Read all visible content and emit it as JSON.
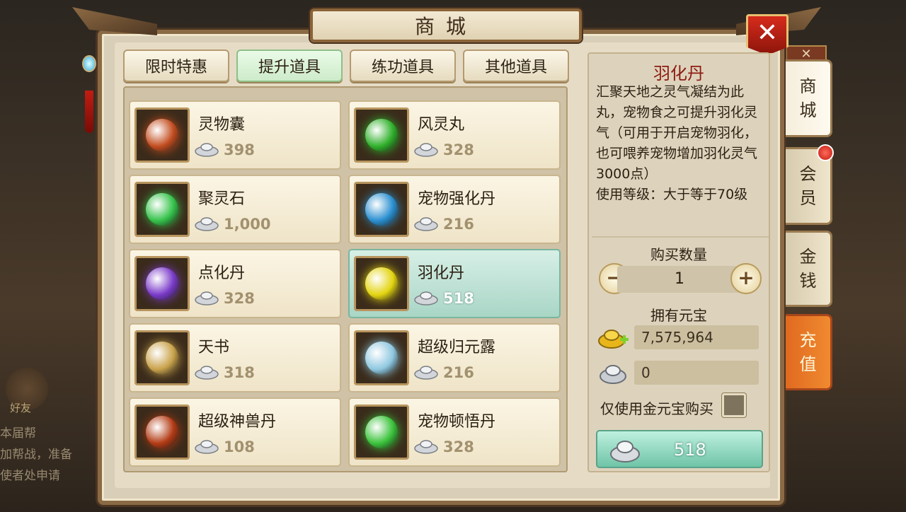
{
  "window": {
    "title": "商城",
    "close_label": "✕"
  },
  "background": {
    "badge_text": "好友",
    "lines": [
      "本届帮",
      "加帮战，准备",
      "使者处申请"
    ],
    "tag": ""
  },
  "tabs": [
    {
      "label": "限时特惠",
      "active": false
    },
    {
      "label": "提升道具",
      "active": true
    },
    {
      "label": "练功道具",
      "active": false
    },
    {
      "label": "其他道具",
      "active": false
    }
  ],
  "items": [
    {
      "name": "灵物囊",
      "price": "398",
      "icon": "lingwu-bag-icon",
      "color": "#c24c1e",
      "selected": false
    },
    {
      "name": "风灵丸",
      "price": "328",
      "icon": "fengling-pill-icon",
      "color": "#2fb02a",
      "selected": false
    },
    {
      "name": "聚灵石",
      "price": "1,000",
      "icon": "juling-stone-icon",
      "color": "#35c24a",
      "selected": false
    },
    {
      "name": "宠物强化丹",
      "price": "216",
      "icon": "pet-enhance-pill-icon",
      "color": "#2a8fd0",
      "selected": false
    },
    {
      "name": "点化丹",
      "price": "328",
      "icon": "dianhua-pill-icon",
      "color": "#7a3ac9",
      "selected": false
    },
    {
      "name": "羽化丹",
      "price": "518",
      "icon": "yuhua-pill-icon",
      "color": "#e3d410",
      "selected": true
    },
    {
      "name": "天书",
      "price": "318",
      "icon": "heavenly-book-icon",
      "color": "#c9a24a",
      "selected": false
    },
    {
      "name": "超级归元露",
      "price": "216",
      "icon": "guiyuan-potion-icon",
      "color": "#8fc8e0",
      "selected": false
    },
    {
      "name": "超级神兽丹",
      "price": "108",
      "icon": "shenshou-pill-icon",
      "color": "#b23a14",
      "selected": false
    },
    {
      "name": "宠物顿悟丹",
      "price": "328",
      "icon": "pet-enlightenment-pill-icon",
      "color": "#3ac23a",
      "selected": false
    }
  ],
  "detail": {
    "title": "羽化丹",
    "description": "汇聚天地之灵气凝结为此丸，宠物食之可提升羽化灵气（可用于开启宠物羽化，也可喂养宠物增加羽化灵气3000点）",
    "level_req": "使用等级：大于等于70级",
    "qty_label": "购买数量",
    "qty_value": "1",
    "minus": "−",
    "plus": "+",
    "own_label": "拥有元宝",
    "gold_amount": "7,575,964",
    "silver_amount": "0",
    "gold_only_label": "仅使用金元宝购买",
    "buy_price": "518"
  },
  "side_tabs": [
    {
      "label": "商\n城",
      "active": true
    },
    {
      "label": "会\n员",
      "active": false,
      "badge": true
    },
    {
      "label": "金\n钱",
      "active": false
    },
    {
      "label": "充\n值",
      "recharge": true
    }
  ],
  "colors": {
    "accent_red": "#8e1b12",
    "selected_green": "#a9d6c6",
    "frame_brown": "#8a6a45"
  }
}
